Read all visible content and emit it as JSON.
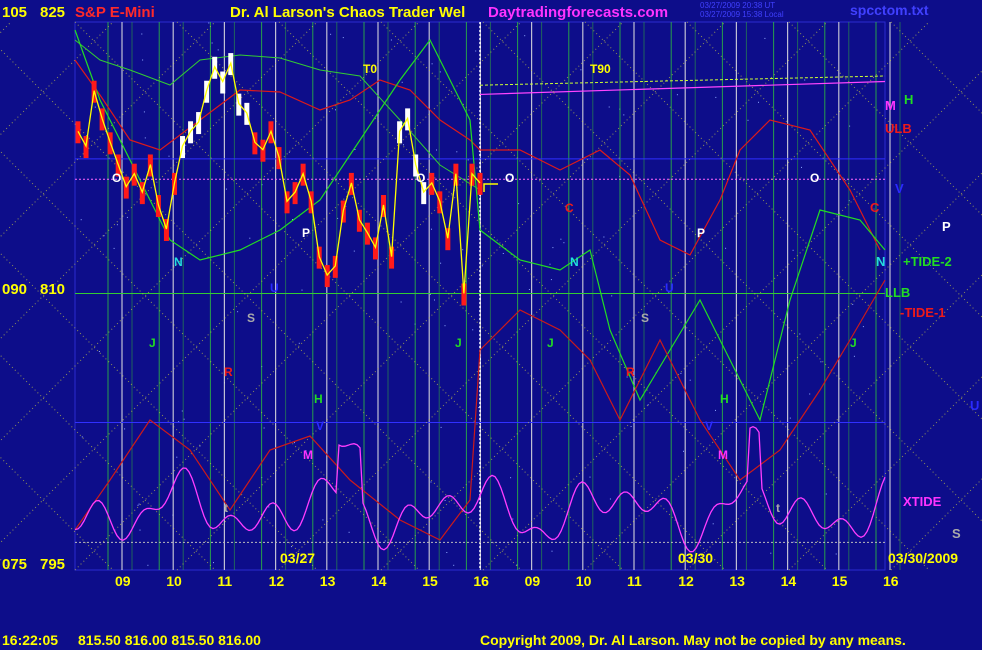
{
  "header": {
    "left_scale": "105",
    "price_top": "825",
    "symbol": "S&P E-Mini",
    "title": "Dr. Al Larson's Chaos Trader Wel",
    "site": "Daytradingforecasts.com",
    "info_line1": "03/27/2009 20:38 UT",
    "info_line2": "03/27/2009 15:38 Local",
    "filename": "spcctom.txt"
  },
  "y_axis": {
    "left_labels": [
      {
        "scale": "105",
        "price": "825"
      },
      {
        "scale": "090",
        "price": "810"
      },
      {
        "scale": "075",
        "price": "795"
      }
    ]
  },
  "footer": {
    "time": "16:22:05",
    "quote": "815.50 816.00 815.50 816.00",
    "copyright": "Copyright 2009, Dr. Al Larson. May not be copied by any means."
  },
  "colors": {
    "background": "#0d0d8a",
    "price_red": "#ff1a1a",
    "price_white": "#ffffff",
    "tide_green": "#22dd22",
    "tide_red": "#dd1a1a",
    "xtide": "#ff3dff",
    "yellow": "#ffff00"
  },
  "chart_data": {
    "type": "line",
    "title": "S&P E-Mini",
    "ylim": [
      795,
      825
    ],
    "yticks": [
      795,
      810,
      825
    ],
    "hour_ticks": [
      "09",
      "10",
      "11",
      "12",
      "13",
      "14",
      "15",
      "16",
      "09",
      "10",
      "11",
      "12",
      "13",
      "14",
      "15",
      "16"
    ],
    "date_labels": [
      "03/27",
      "03/30",
      "03/30/2009"
    ],
    "price_series": [
      {
        "x": 0.0,
        "y": 818.8
      },
      {
        "x": 0.2,
        "y": 818.0
      },
      {
        "x": 0.4,
        "y": 821.0
      },
      {
        "x": 0.6,
        "y": 819.5
      },
      {
        "x": 0.8,
        "y": 818.2
      },
      {
        "x": 1.0,
        "y": 817.0
      },
      {
        "x": 1.2,
        "y": 815.8
      },
      {
        "x": 1.4,
        "y": 816.5
      },
      {
        "x": 1.6,
        "y": 815.5
      },
      {
        "x": 1.8,
        "y": 817.0
      },
      {
        "x": 2.0,
        "y": 814.8
      },
      {
        "x": 2.2,
        "y": 813.5
      },
      {
        "x": 2.4,
        "y": 816.0
      },
      {
        "x": 2.6,
        "y": 818.0
      },
      {
        "x": 2.8,
        "y": 818.8
      },
      {
        "x": 3.0,
        "y": 819.3
      },
      {
        "x": 3.2,
        "y": 821.0
      },
      {
        "x": 3.4,
        "y": 822.3
      },
      {
        "x": 3.6,
        "y": 821.5
      },
      {
        "x": 3.8,
        "y": 822.5
      },
      {
        "x": 4.0,
        "y": 820.3
      },
      {
        "x": 4.2,
        "y": 819.8
      },
      {
        "x": 4.4,
        "y": 818.2
      },
      {
        "x": 4.6,
        "y": 817.8
      },
      {
        "x": 4.8,
        "y": 818.8
      },
      {
        "x": 5.0,
        "y": 817.4
      },
      {
        "x": 5.2,
        "y": 815.0
      },
      {
        "x": 5.4,
        "y": 815.5
      },
      {
        "x": 5.6,
        "y": 816.5
      },
      {
        "x": 5.8,
        "y": 815.0
      },
      {
        "x": 6.0,
        "y": 812.0
      },
      {
        "x": 6.2,
        "y": 811.0
      },
      {
        "x": 6.4,
        "y": 811.5
      },
      {
        "x": 6.6,
        "y": 814.5
      },
      {
        "x": 6.8,
        "y": 816.0
      },
      {
        "x": 7.0,
        "y": 814.0
      },
      {
        "x": 7.2,
        "y": 813.3
      },
      {
        "x": 7.4,
        "y": 812.5
      },
      {
        "x": 7.6,
        "y": 814.8
      },
      {
        "x": 7.8,
        "y": 812.0
      },
      {
        "x": 8.0,
        "y": 818.8
      },
      {
        "x": 8.2,
        "y": 819.5
      },
      {
        "x": 8.4,
        "y": 817.0
      },
      {
        "x": 8.6,
        "y": 815.5
      },
      {
        "x": 8.8,
        "y": 816.0
      },
      {
        "x": 9.0,
        "y": 815.0
      },
      {
        "x": 9.2,
        "y": 813.0
      },
      {
        "x": 9.4,
        "y": 816.5
      },
      {
        "x": 9.6,
        "y": 810.0
      },
      {
        "x": 9.8,
        "y": 816.5
      },
      {
        "x": 10.0,
        "y": 816.0
      }
    ],
    "forecast_levels": [
      {
        "name": "T0",
        "value": 821.0
      },
      {
        "name": "T90",
        "value": 821.0
      }
    ],
    "right_labels": [
      "M",
      "H",
      "ULB",
      "V",
      "C",
      "P",
      "+TIDE-2",
      "N",
      "LLB",
      "-TIDE-1",
      "U",
      "XTIDE",
      "S"
    ],
    "chart_letters": [
      "O",
      "N",
      "P",
      "U",
      "S",
      "J",
      "R",
      "H",
      "V",
      "M",
      "t",
      "T0",
      "T90",
      "C"
    ]
  }
}
